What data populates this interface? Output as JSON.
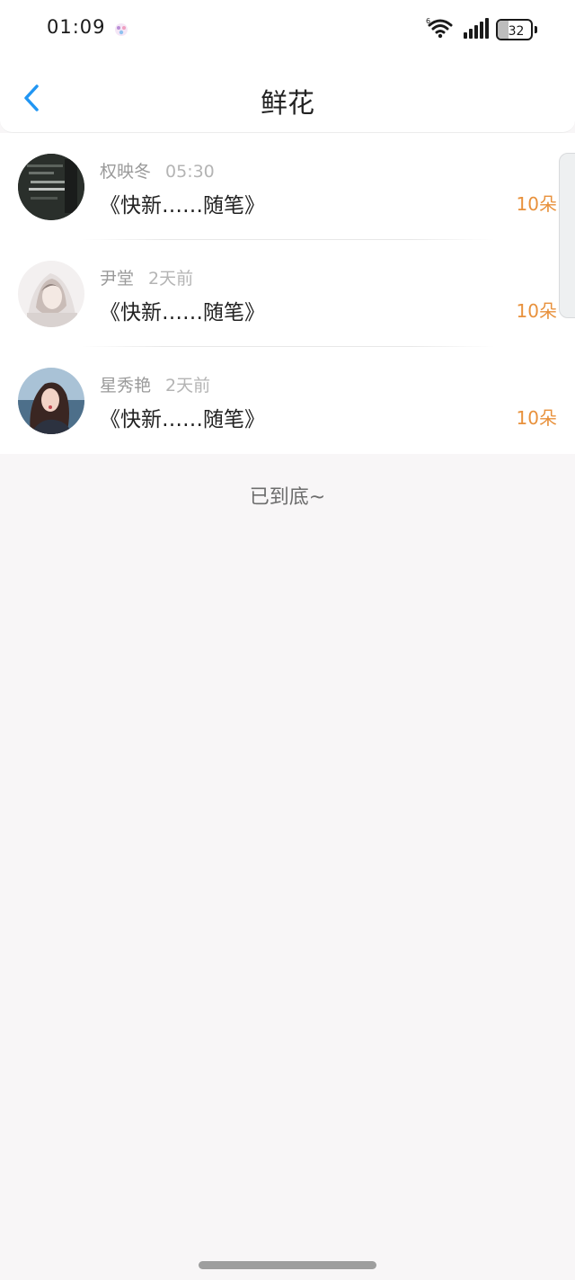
{
  "status_bar": {
    "time": "01:09",
    "battery_level": "32",
    "battery_fraction": 0.32,
    "wifi_label": "6"
  },
  "nav": {
    "title": "鲜花"
  },
  "entries": [
    {
      "name": "权映冬",
      "time": "05:30",
      "title": "《快新……随笔》",
      "count": "10朵"
    },
    {
      "name": "尹堂",
      "time": "2天前",
      "title": "《快新……随笔》",
      "count": "10朵"
    },
    {
      "name": "星秀艳",
      "time": "2天前",
      "title": "《快新……随笔》",
      "count": "10朵"
    }
  ],
  "footer": {
    "end_text": "已到底~"
  },
  "colors": {
    "accent": "#2196f3",
    "count": "#e8913c"
  }
}
